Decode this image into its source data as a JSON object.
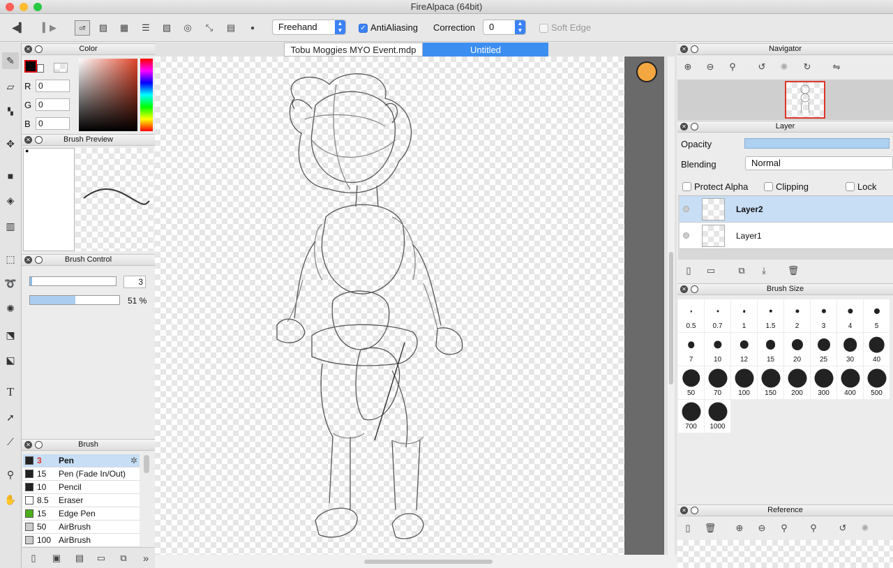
{
  "window": {
    "title": "FireAlpaca (64bit)"
  },
  "toolbar": {
    "stroke_mode": "Freehand",
    "antialiasing_label": "AntiAliasing",
    "antialiasing_checked": true,
    "correction_label": "Correction",
    "correction_value": "0",
    "soft_edge_label": "Soft Edge",
    "snap_off_label": "off"
  },
  "color_panel": {
    "title": "Color",
    "r_label": "R",
    "r": "0",
    "g_label": "G",
    "g": "0",
    "b_label": "B",
    "b": "0",
    "foreground": "#000000"
  },
  "brush_preview": {
    "title": "Brush Preview"
  },
  "brush_control": {
    "title": "Brush Control",
    "size": "3",
    "opacity": "51 %",
    "opacity_fraction": 0.51
  },
  "brush_panel": {
    "title": "Brush",
    "items": [
      {
        "size": "3",
        "name": "Pen",
        "color": "#222222",
        "selected": true
      },
      {
        "size": "15",
        "name": "Pen (Fade In/Out)",
        "color": "#222222"
      },
      {
        "size": "10",
        "name": "Pencil",
        "color": "#222222"
      },
      {
        "size": "8.5",
        "name": "Eraser",
        "color": "#ffffff"
      },
      {
        "size": "15",
        "name": "Edge Pen",
        "color": "#4caf1a"
      },
      {
        "size": "50",
        "name": "AirBrush",
        "color": "#cccccc"
      },
      {
        "size": "100",
        "name": "AirBrush",
        "color": "#cccccc"
      }
    ]
  },
  "tabs": [
    {
      "label": "Tobu Moggies MYO Event.mdp",
      "active": false
    },
    {
      "label": "Untitled",
      "active": true
    }
  ],
  "navigator": {
    "title": "Navigator"
  },
  "layer_panel": {
    "title": "Layer",
    "opacity_label": "Opacity",
    "blending_label": "Blending",
    "blending_value": "Normal",
    "protect_alpha": "Protect Alpha",
    "clipping": "Clipping",
    "lock": "Lock",
    "layers": [
      {
        "name": "Layer2",
        "selected": true
      },
      {
        "name": "Layer1",
        "selected": false
      }
    ]
  },
  "brush_size": {
    "title": "Brush Size",
    "sizes": [
      "0.5",
      "0.7",
      "1",
      "1.5",
      "2",
      "3",
      "4",
      "5",
      "7",
      "10",
      "12",
      "15",
      "20",
      "25",
      "30",
      "40",
      "50",
      "70",
      "100",
      "150",
      "200",
      "300",
      "400",
      "500",
      "700",
      "1000"
    ]
  },
  "reference": {
    "title": "Reference"
  },
  "icons": [
    "pen-icon",
    "eraser-icon",
    "dot-icon",
    "move-icon",
    "fill-rect-icon",
    "bucket-icon",
    "gradient-icon",
    "select-icon",
    "lasso-icon",
    "magic-wand-icon",
    "select-pen-icon",
    "select-eraser-icon",
    "text-icon",
    "operation-icon",
    "divide-icon",
    "eyedropper-icon",
    "hand-icon"
  ]
}
